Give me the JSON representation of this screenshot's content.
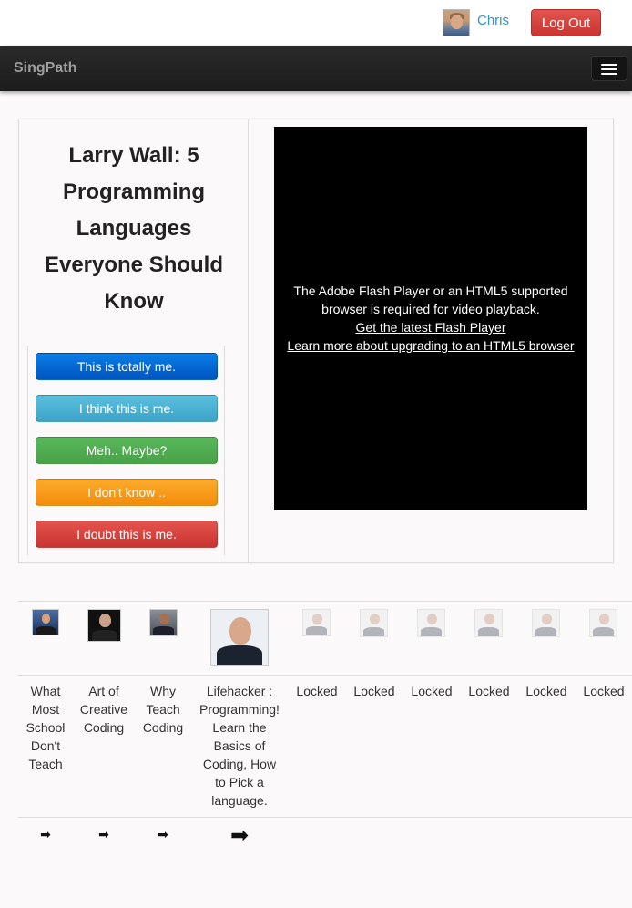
{
  "user": {
    "name": "Chris",
    "logout_label": "Log Out"
  },
  "navbar": {
    "brand": "SingPath"
  },
  "challenge": {
    "title": "Larry Wall: 5 Programming Languages Everyone Should Know",
    "choices": [
      {
        "label": "This is totally me.",
        "color": "#0565d6"
      },
      {
        "label": "I think this is me.",
        "color": "#49afd6"
      },
      {
        "label": "Meh.. Maybe?",
        "color": "#51ad51"
      },
      {
        "label": "I don't know ..",
        "color": "#f79a1c"
      },
      {
        "label": "I doubt this is me.",
        "color": "#d7443f"
      }
    ]
  },
  "video": {
    "message": "The Adobe Flash Player or an HTML5 supported browser is required for video playback.",
    "link1": "Get the latest Flash Player",
    "link2": "Learn more about upgrading to an HTML5 browser"
  },
  "lessons": [
    {
      "title": "What Most School Don't Teach",
      "icon": "arrow-right-icon"
    },
    {
      "title": "Art of Creative Coding",
      "icon": "arrow-right-icon"
    },
    {
      "title": "Why Teach Coding",
      "icon": "arrow-right-icon"
    },
    {
      "title": "Lifehacker : Programming! Learn the Basics of Coding, How to Pick a language.",
      "icon": "arrow-right-icon",
      "current": true
    },
    {
      "title": "Locked"
    },
    {
      "title": "Locked"
    },
    {
      "title": "Locked"
    },
    {
      "title": "Locked"
    },
    {
      "title": "Locked"
    },
    {
      "title": "Locked"
    }
  ],
  "arrow_glyph": "➡"
}
